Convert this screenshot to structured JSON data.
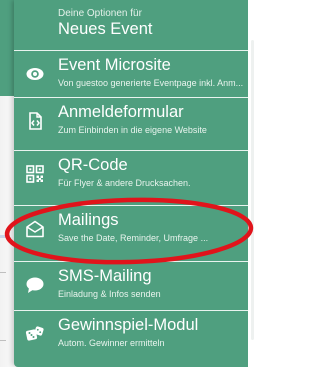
{
  "panel": {
    "subtitle": "Deine Optionen für",
    "title": "Neues Event",
    "background_color": "#4f9f7f"
  },
  "menu": {
    "items": [
      {
        "id": "event-microsite",
        "icon": "eye-icon",
        "label": "Event Microsite",
        "description": "Von guestoo generierte Eventpage inkl. Anm..."
      },
      {
        "id": "anmeldeformular",
        "icon": "code-file-icon",
        "label": "Anmeldeformular",
        "description": "Zum Einbinden in die eigene Website"
      },
      {
        "id": "qr-code",
        "icon": "qr-code-icon",
        "label": "QR-Code",
        "description": "Für Flyer & andere Drucksachen."
      },
      {
        "id": "mailings",
        "icon": "envelope-open-icon",
        "label": "Mailings",
        "description": "Save the Date, Reminder, Umfrage ..."
      },
      {
        "id": "sms-mailing",
        "icon": "sms-bubble-icon",
        "label": "SMS-Mailing",
        "description": "Einladung & Infos senden"
      },
      {
        "id": "gewinnspiel-modul",
        "icon": "dice-icon",
        "label": "Gewinnspiel-Modul",
        "description": "Autom. Gewinner ermitteln"
      }
    ]
  },
  "annotation": {
    "type": "ellipse",
    "target": "mailings",
    "color": "#e0141b"
  }
}
